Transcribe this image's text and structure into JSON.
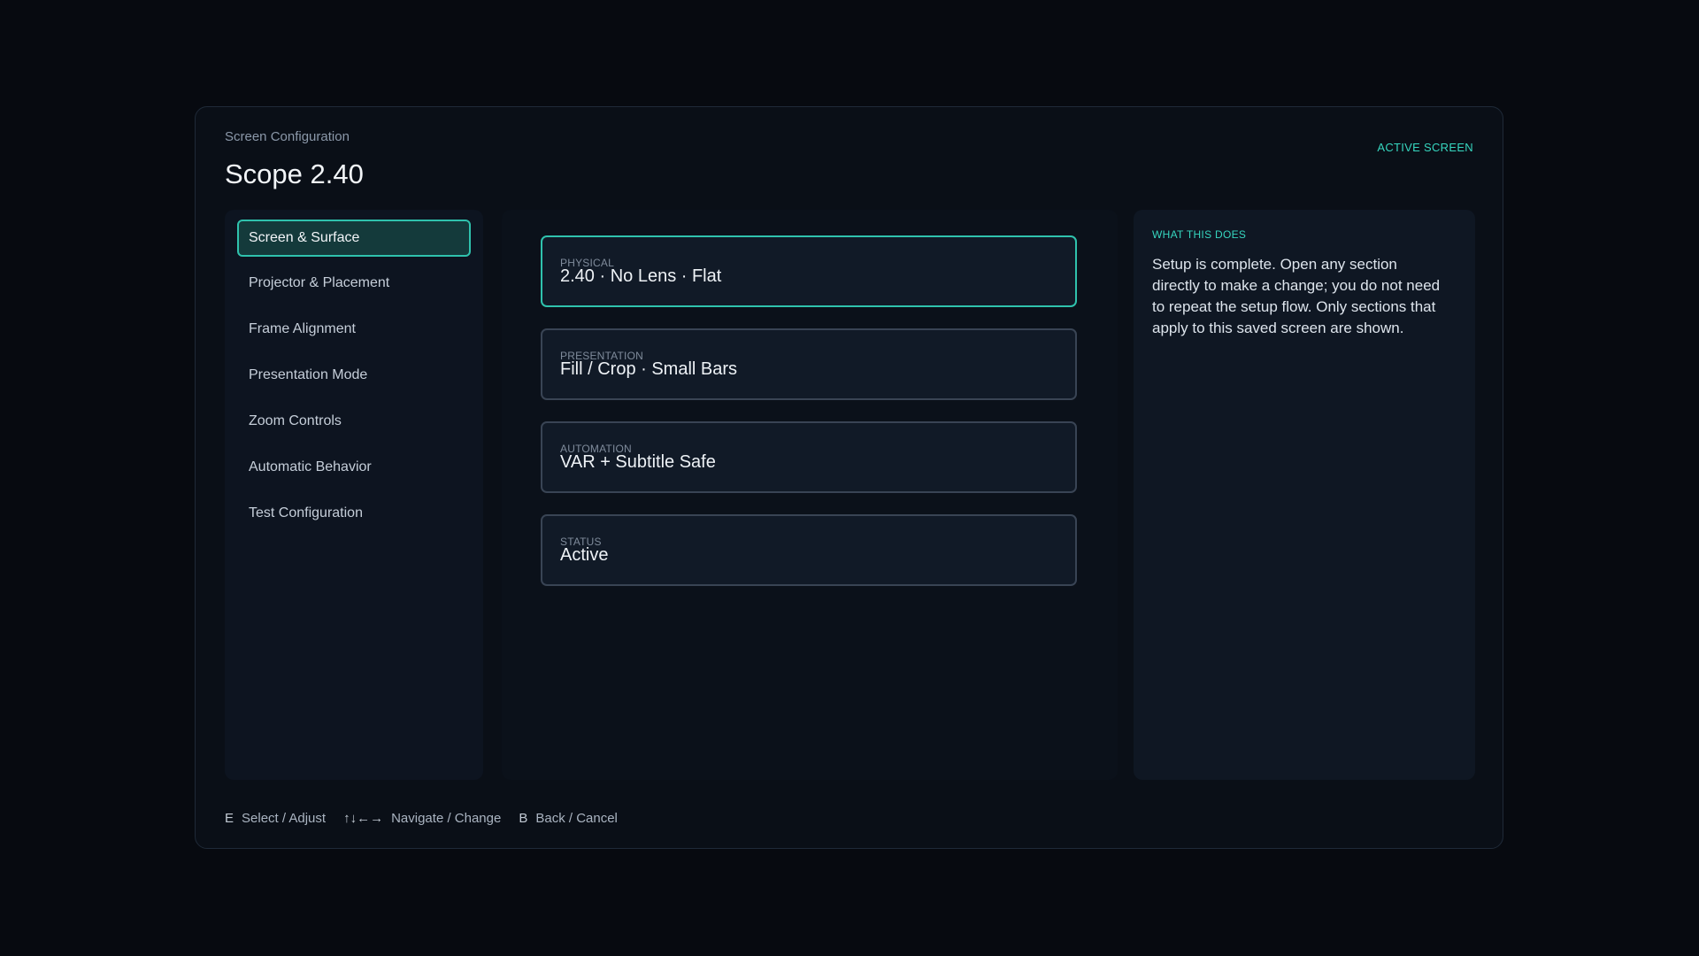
{
  "header": {
    "eyebrow": "Screen Configuration",
    "title": "Scope 2.40",
    "badge": "ACTIVE SCREEN"
  },
  "sidebar": {
    "items": [
      {
        "label": "Screen & Surface",
        "selected": true
      },
      {
        "label": "Projector & Placement",
        "selected": false
      },
      {
        "label": "Frame Alignment",
        "selected": false
      },
      {
        "label": "Presentation Mode",
        "selected": false
      },
      {
        "label": "Zoom Controls",
        "selected": false
      },
      {
        "label": "Automatic Behavior",
        "selected": false
      },
      {
        "label": "Test Configuration",
        "selected": false
      }
    ]
  },
  "cards": [
    {
      "label": "PHYSICAL",
      "value": "2.40 · No Lens · Flat",
      "selected": true
    },
    {
      "label": "PRESENTATION",
      "value": "Fill / Crop · Small Bars",
      "selected": false
    },
    {
      "label": "AUTOMATION",
      "value": "VAR + Subtitle Safe",
      "selected": false
    },
    {
      "label": "STATUS",
      "value": "Active",
      "selected": false
    }
  ],
  "info": {
    "heading": "WHAT THIS DOES",
    "body": "Setup is complete. Open any section directly to make a change; you do not need to repeat the setup flow. Only sections that apply to this saved screen are shown."
  },
  "footer": {
    "hints": [
      {
        "key": "E",
        "action": "Select / Adjust"
      },
      {
        "key": "↑↓←→",
        "action": "Navigate / Change"
      },
      {
        "key": "B",
        "action": "Back / Cancel"
      }
    ]
  },
  "colors": {
    "accent": "#36d6bf",
    "background": "#070a10",
    "panel": "#0a0f17"
  }
}
